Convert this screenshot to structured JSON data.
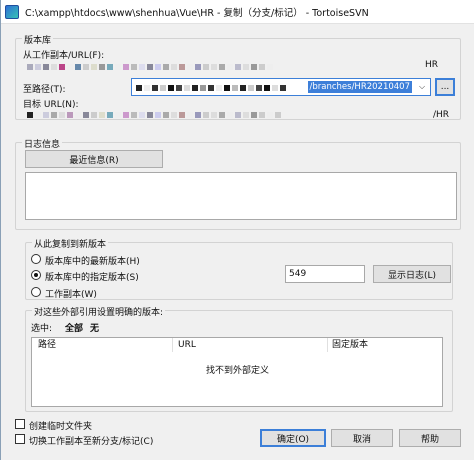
{
  "window": {
    "title": "C:\\xampp\\htdocs\\www\\shenhua\\Vue\\HR - 复制（分支/标记） - TortoiseSVN"
  },
  "repository": {
    "group_label": "版本库",
    "from_label": "从工作副本/URL(F):",
    "from_suffix": "HR",
    "to_label": "至路径(T):",
    "to_value": "/branches/HR20210407",
    "browse_label": "...",
    "target_label": "目标 URL(N):",
    "target_suffix": "/HR"
  },
  "log": {
    "group_label": "日志信息",
    "recent_button": "最近信息(R)"
  },
  "copy_from": {
    "group_label": "从此复制到新版本",
    "options": [
      {
        "label": "版本库中的最新版本(H)",
        "selected": false
      },
      {
        "label": "版本库中的指定版本(S)",
        "selected": true
      },
      {
        "label": "工作副本(W)",
        "selected": false
      }
    ],
    "revision_value": "549",
    "show_log_button": "显示日志(L)"
  },
  "externals": {
    "group_label": "对这些外部引用设置明确的版本:",
    "select_label": "选中:",
    "select_all": "全部",
    "select_none": "无",
    "columns": [
      "路径",
      "URL",
      "固定版本"
    ],
    "empty_text": "找不到外部定义"
  },
  "options": {
    "create_folders": "创建临时文件夹",
    "switch_wc": "切换工作副本至新分支/标记(C)"
  },
  "buttons": {
    "ok": "确定(O)",
    "cancel": "取消",
    "help": "帮助"
  },
  "colors": {
    "selection": "#3d7fd9",
    "window_bg": "#f0f0f0"
  }
}
